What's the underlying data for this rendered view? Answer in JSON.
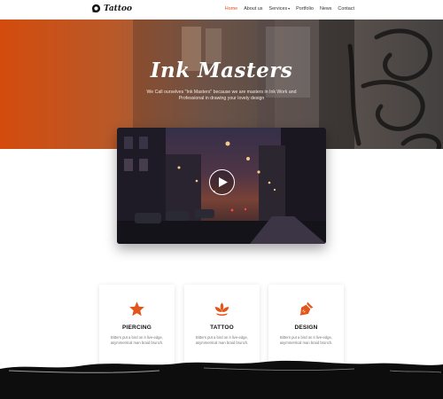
{
  "brand": {
    "name": "Tattoo",
    "accent": "#e2551b"
  },
  "nav": {
    "items": [
      {
        "label": "Home",
        "active": true
      },
      {
        "label": "About us"
      },
      {
        "label": "Services",
        "has_dropdown": true
      },
      {
        "label": "Portfolio"
      },
      {
        "label": "News"
      },
      {
        "label": "Contact"
      }
    ]
  },
  "hero": {
    "title": "Ink Masters",
    "subtitle": "We Call ourselves \"Ink Masters\" because we are masters in Ink Work and Professional in drawing your lovely design"
  },
  "video": {
    "play_icon": "play-icon"
  },
  "services": [
    {
      "icon": "star-icon",
      "title": "PIERCING",
      "desc": "Bitters put a bird on it live-edge, asymmetrical man braid brunch."
    },
    {
      "icon": "lotus-icon",
      "title": "TATTOO",
      "desc": "Bitters put a bird on it live-edge, asymmetrical man braid brunch."
    },
    {
      "icon": "pen-nib-icon",
      "title": "DESIGN",
      "desc": "Bitters put a bird on it live-edge, asymmetrical man braid brunch."
    }
  ]
}
